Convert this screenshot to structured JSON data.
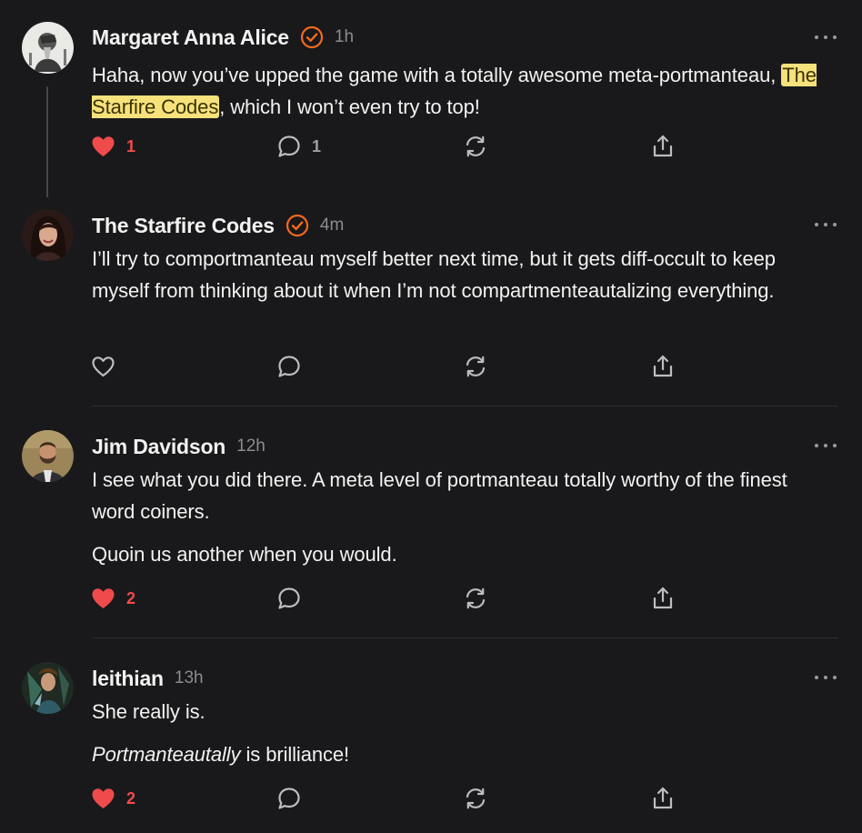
{
  "colors": {
    "background": "#19191b",
    "text": "#f2f2f2",
    "muted": "#8c8c90",
    "like_red": "#ef4b4b",
    "verified_orange": "#f26a1b",
    "highlight": "#f6e17b"
  },
  "comments": [
    {
      "author": "Margaret Anna Alice",
      "verified": true,
      "time": "1h",
      "avatar_icon": "engraving-portrait-avatar",
      "paragraphs": [
        {
          "before": "Haha, now you’ve upped the game with a totally awesome meta-portmanteau, ",
          "highlight": "The Starfire Codes",
          "after": ", which I won’t even try to top!"
        }
      ],
      "likes": "1",
      "liked": true,
      "replies": "1"
    },
    {
      "author": "The Starfire Codes",
      "verified": true,
      "time": "4m",
      "avatar_icon": "woman-portrait-avatar",
      "paragraphs": [
        {
          "text": "I’ll try to comportmanteau myself better next time, but it gets diff-occult to keep myself from thinking about it when I’m not compartmenteautalizing everything."
        }
      ],
      "likes": "",
      "liked": false,
      "replies": ""
    },
    {
      "author": "Jim Davidson",
      "verified": false,
      "time": "12h",
      "avatar_icon": "bearded-man-avatar",
      "paragraphs": [
        {
          "text": "I see what you did there. A meta level of portmanteau totally worthy of the finest word coiners."
        },
        {
          "text": "Quoin us another when you would."
        }
      ],
      "likes": "2",
      "liked": true,
      "replies": ""
    },
    {
      "author": "leithian",
      "verified": false,
      "time": "13h",
      "avatar_icon": "fantasy-character-avatar",
      "paragraphs": [
        {
          "text": "She really is."
        },
        {
          "italic": "Portmanteautally",
          "after": " is brilliance!"
        }
      ],
      "likes": "2",
      "liked": true,
      "replies": ""
    }
  ]
}
